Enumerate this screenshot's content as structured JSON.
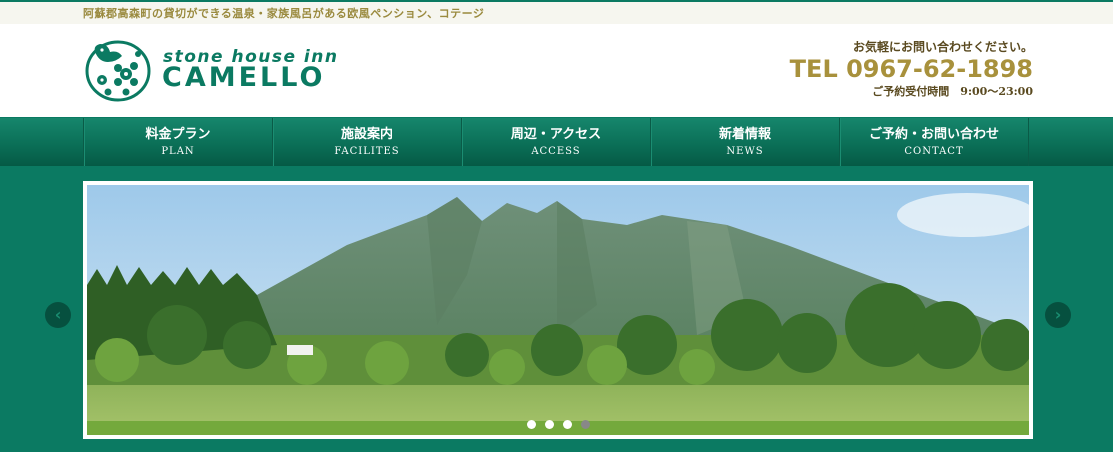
{
  "topbar": {
    "tagline": "阿蘇郡高森町の貸切ができる温泉・家族風呂がある欧風ペンション、コテージ"
  },
  "brand": {
    "tagline": "stone house inn",
    "name": "CAMELLO"
  },
  "contact": {
    "lead": "お気軽にお問い合わせください。",
    "tel": "TEL 0967-62-1898",
    "hours": "ご予約受付時間　9:00～23:00"
  },
  "nav": {
    "items": [
      {
        "jp": "料金プラン",
        "en": "PLAN"
      },
      {
        "jp": "施設案内",
        "en": "FACILITES"
      },
      {
        "jp": "周辺・アクセス",
        "en": "ACCESS"
      },
      {
        "jp": "新着情報",
        "en": "NEWS"
      },
      {
        "jp": "ご予約・お問い合わせ",
        "en": "CONTACT"
      }
    ]
  },
  "slider": {
    "prev_icon": "‹",
    "next_icon": "›",
    "slide_count": 4,
    "active_index": 3
  },
  "colors": {
    "brand_green": "#0b7a62",
    "gold": "#a8913c"
  }
}
